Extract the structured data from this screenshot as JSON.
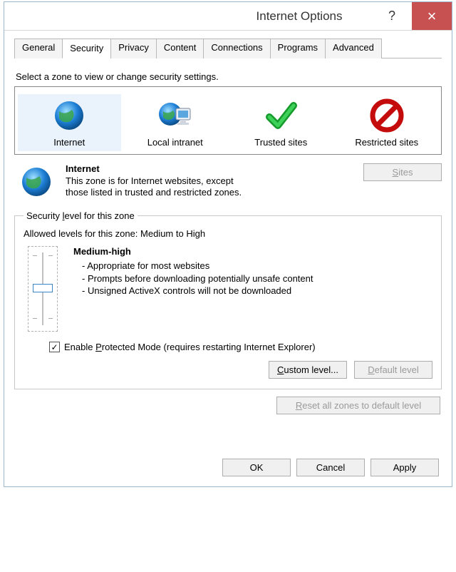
{
  "title": "Internet Options",
  "tabs": [
    "General",
    "Security",
    "Privacy",
    "Content",
    "Connections",
    "Programs",
    "Advanced"
  ],
  "active_tab": "Security",
  "zone_prompt": "Select a zone to view or change security settings.",
  "zones": {
    "internet": "Internet",
    "intranet": "Local intranet",
    "trusted": "Trusted sites",
    "restricted": "Restricted sites"
  },
  "zone_desc": {
    "title": "Internet",
    "text": "This zone is for Internet websites, except those listed in trusted and restricted zones."
  },
  "sites_button": "Sites",
  "security_level": {
    "legend": "Security level for this zone",
    "allowed": "Allowed levels for this zone: Medium to High",
    "name": "Medium-high",
    "bullets": [
      "- Appropriate for most websites",
      "- Prompts before downloading potentially unsafe content",
      "- Unsigned ActiveX controls will not be downloaded"
    ],
    "protected_mode": "Enable Protected Mode (requires restarting Internet Explorer)",
    "protected_mode_checked": true,
    "custom_level": "Custom level...",
    "default_level": "Default level"
  },
  "reset_all": "Reset all zones to default level",
  "dialog_buttons": {
    "ok": "OK",
    "cancel": "Cancel",
    "apply": "Apply"
  }
}
